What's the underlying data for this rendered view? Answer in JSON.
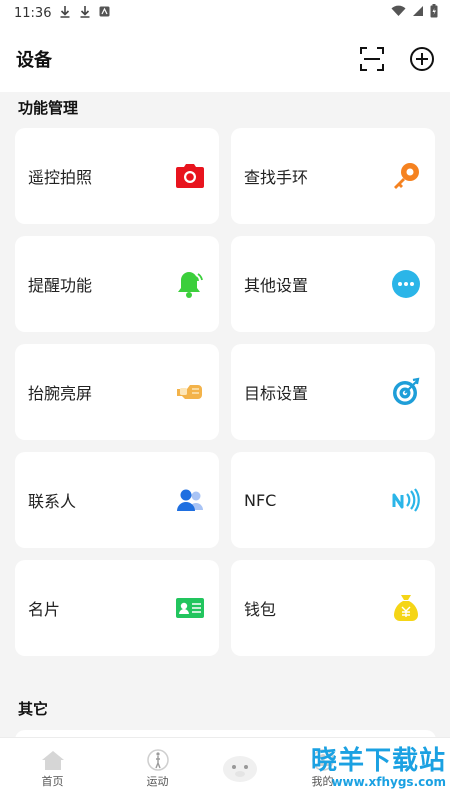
{
  "status": {
    "time": "11:36"
  },
  "header": {
    "title": "设备"
  },
  "sections": {
    "functions": "功能管理",
    "other": "其它"
  },
  "cards": [
    {
      "label": "遥控拍照",
      "icon": "camera-icon",
      "color": "#e8141e"
    },
    {
      "label": "查找手环",
      "icon": "key-icon",
      "color": "#f58220"
    },
    {
      "label": "提醒功能",
      "icon": "bell-icon",
      "color": "#3ccf3c"
    },
    {
      "label": "其他设置",
      "icon": "more-icon",
      "color": "#2bb5e8"
    },
    {
      "label": "抬腕亮屏",
      "icon": "wrist-icon",
      "color": "#f3b34a"
    },
    {
      "label": "目标设置",
      "icon": "target-icon",
      "color": "#1e9ed8"
    },
    {
      "label": "联系人",
      "icon": "contacts-icon",
      "color": "#1f6fe0"
    },
    {
      "label": "NFC",
      "icon": "nfc-icon",
      "color": "#2bb5e8"
    },
    {
      "label": "名片",
      "icon": "card-icon",
      "color": "#22c55e"
    },
    {
      "label": "钱包",
      "icon": "wallet-icon",
      "color": "#f5d516"
    }
  ],
  "tabs": [
    {
      "label": "首页",
      "icon": "home-icon"
    },
    {
      "label": "运动",
      "icon": "run-icon"
    },
    {
      "label": "我的",
      "icon": "profile-icon"
    }
  ],
  "watermark": {
    "text": "晓羊下载站",
    "url": "www.xfhygs.com"
  }
}
